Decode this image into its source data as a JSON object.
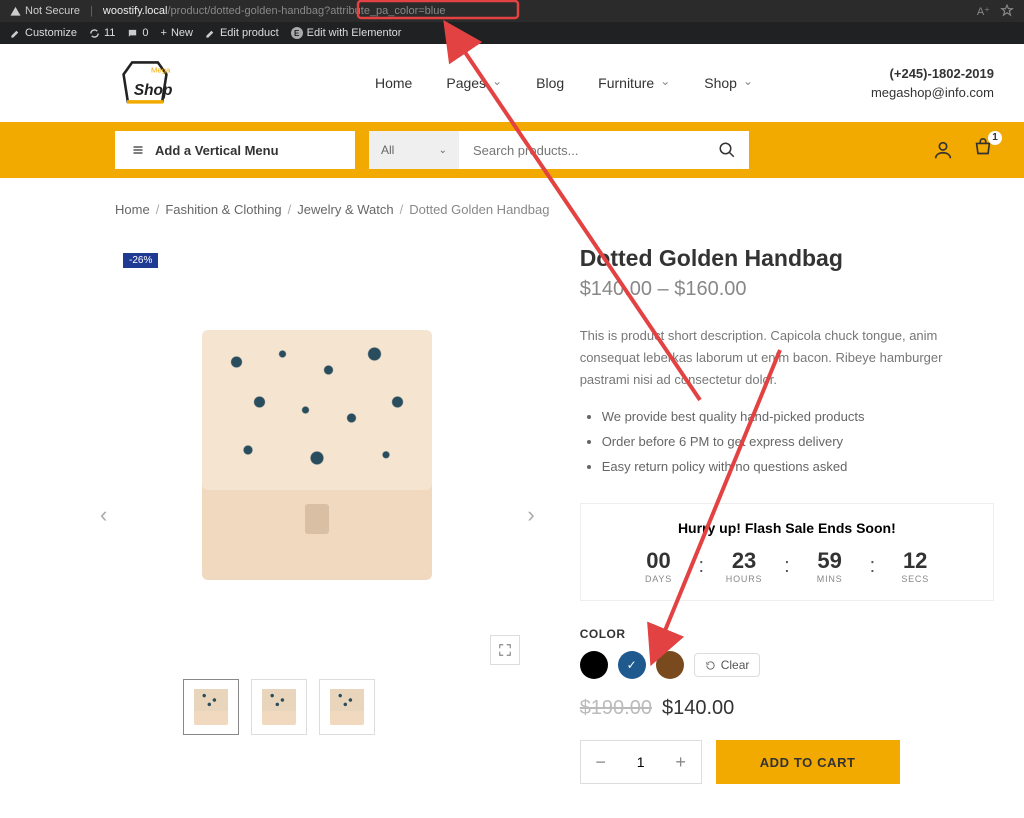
{
  "browser": {
    "not_secure": "Not Secure",
    "url_host": "woostify.local",
    "url_path": "/product/dotted-golden-handbag",
    "url_query": "?attribute_pa_color=blue"
  },
  "wpbar": {
    "customize": "Customize",
    "comments_count": "11",
    "notif_count": "0",
    "new": "New",
    "edit_product": "Edit product",
    "elementor": "Edit with Elementor"
  },
  "header": {
    "logo_primary": "Shop",
    "logo_secondary": "Mega",
    "nav": [
      "Home",
      "Pages",
      "Blog",
      "Furniture",
      "Shop"
    ],
    "phone": "(+245)-1802-2019",
    "email": "megashop@info.com"
  },
  "searchbar": {
    "menu_label": "Add a Vertical Menu",
    "category_label": "All",
    "placeholder": "Search products...",
    "cart_count": "1"
  },
  "breadcrumb": [
    "Home",
    "Fashition & Clothing",
    "Jewelry & Watch",
    "Dotted Golden Handbag"
  ],
  "product": {
    "discount_badge": "-26%",
    "title": "Dotted Golden Handbag",
    "price_range": "$140.00 – $160.00",
    "description": "This is product short description. Capicola chuck tongue, anim consequat leberkas laborum ut enim bacon. Ribeye hamburger pastrami nisi ad consectetur dolor.",
    "bullets": [
      "We provide best quality hand-picked products",
      "Order before 6 PM to get express delivery",
      "Easy return policy with no questions asked"
    ],
    "countdown": {
      "title": "Hurry up! Flash Sale Ends Soon!",
      "days": "00",
      "days_l": "DAYS",
      "hours": "23",
      "hours_l": "HOURS",
      "mins": "59",
      "mins_l": "MINS",
      "secs": "12",
      "secs_l": "SECS"
    },
    "color_label": "COLOR",
    "clear": "Clear",
    "var_price_old": "$190.00",
    "var_price_new": "$140.00",
    "qty": "1",
    "add_to_cart": "ADD TO CART",
    "colors": [
      "black",
      "blue",
      "brown"
    ],
    "selected_color": "blue"
  }
}
